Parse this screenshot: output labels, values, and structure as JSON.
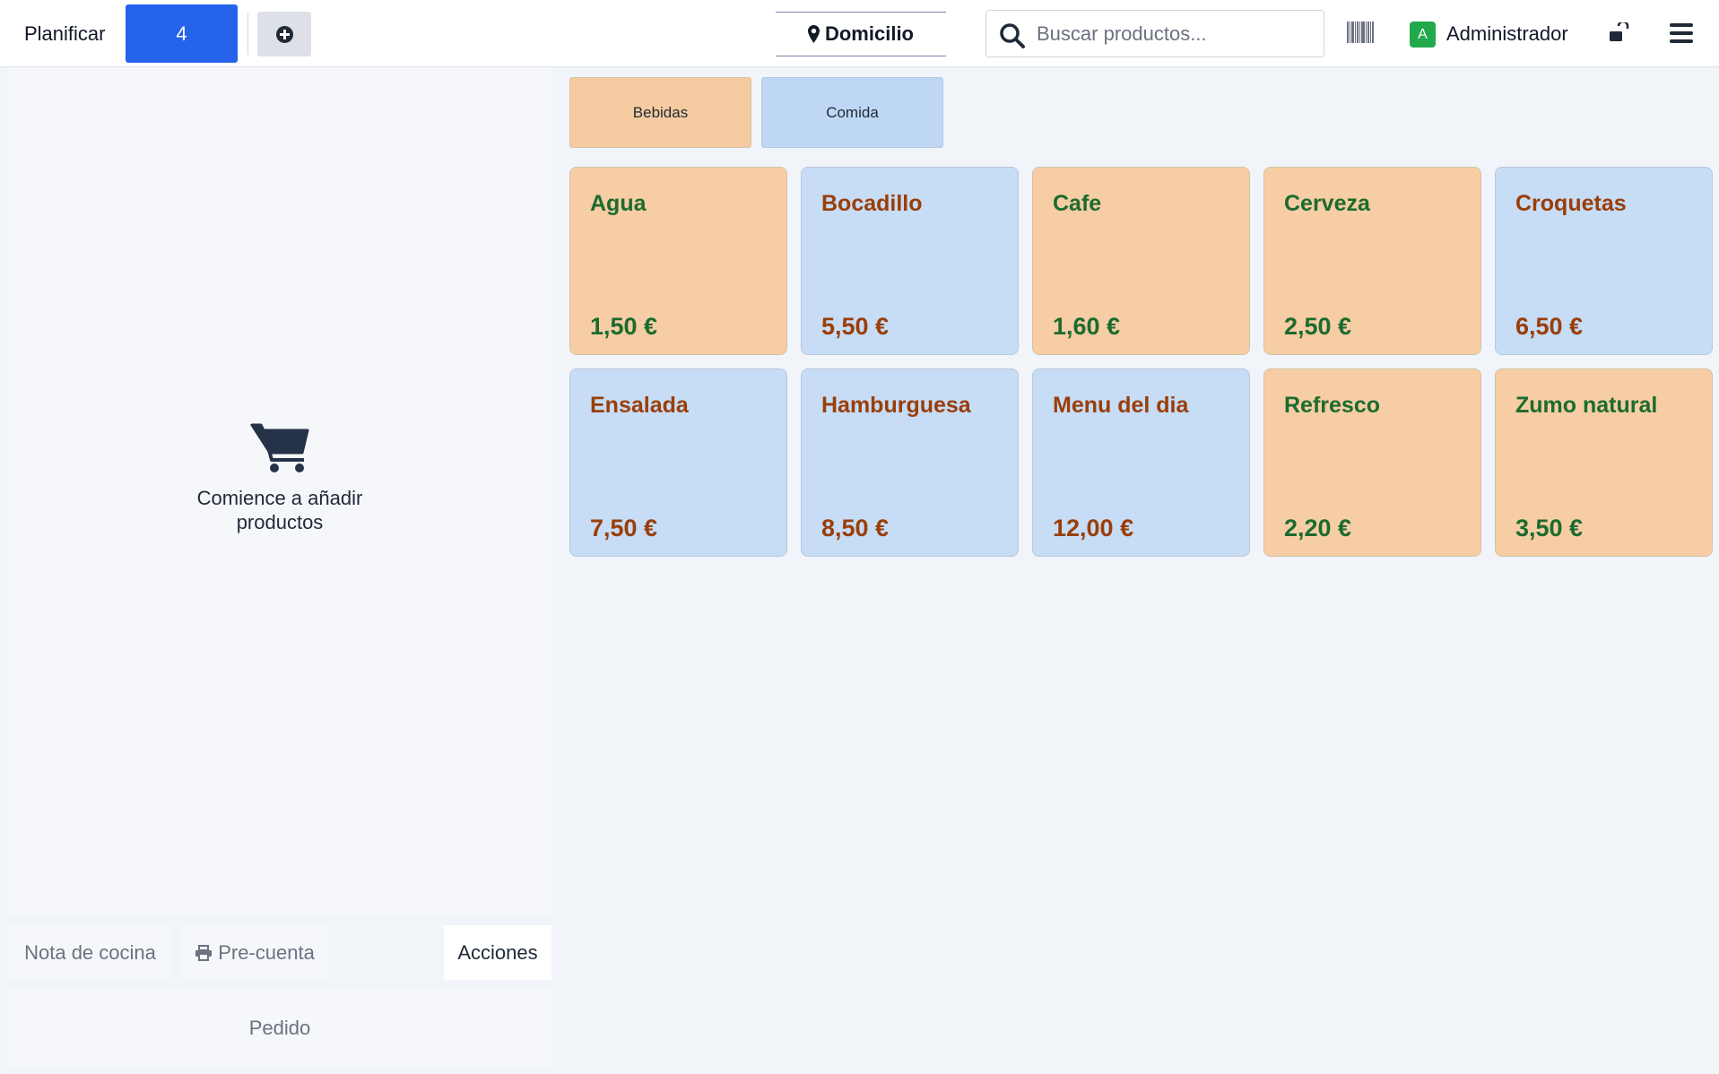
{
  "topbar": {
    "plan_label": "Planificar",
    "order_count": "4",
    "location_label": "Domicilio",
    "search_placeholder": "Buscar productos...",
    "user_initial": "A",
    "user_name": "Administrador",
    "icons": [
      "plus-circle-icon",
      "map-pin-icon",
      "search-icon",
      "barcode-icon",
      "unlock-icon",
      "hamburger-menu-icon"
    ]
  },
  "order": {
    "empty_text": "Comience a añadir productos",
    "kitchen_note_label": "Nota de cocina",
    "pre_bill_label": "Pre-cuenta",
    "actions_label": "Acciones",
    "order_label": "Pedido",
    "icons": [
      "cart-icon",
      "printer-icon"
    ]
  },
  "categories": [
    {
      "label": "Bebidas",
      "color": "#f6cba1"
    },
    {
      "label": "Comida",
      "color": "#bed7f5"
    }
  ],
  "products": [
    {
      "name": "Agua",
      "price": "1,50 €",
      "category": "Bebidas"
    },
    {
      "name": "Bocadillo",
      "price": "5,50 €",
      "category": "Comida"
    },
    {
      "name": "Cafe",
      "price": "1,60 €",
      "category": "Bebidas"
    },
    {
      "name": "Cerveza",
      "price": "2,50 €",
      "category": "Bebidas"
    },
    {
      "name": "Croquetas",
      "price": "6,50 €",
      "category": "Comida"
    },
    {
      "name": "Ensalada",
      "price": "7,50 €",
      "category": "Comida"
    },
    {
      "name": "Hamburguesa",
      "price": "8,50 €",
      "category": "Comida"
    },
    {
      "name": "Menu del dia",
      "price": "12,00 €",
      "category": "Comida"
    },
    {
      "name": "Refresco",
      "price": "2,20 €",
      "category": "Bebidas"
    },
    {
      "name": "Zumo natural",
      "price": "3,50 €",
      "category": "Bebidas"
    }
  ],
  "colors": {
    "accent": "#2563eb",
    "drink_card": "#f6cda4",
    "food_card": "#c7dcf5",
    "drink_text": "#1c6b2e",
    "food_text": "#9a3e09",
    "avatar": "#22a94c"
  }
}
